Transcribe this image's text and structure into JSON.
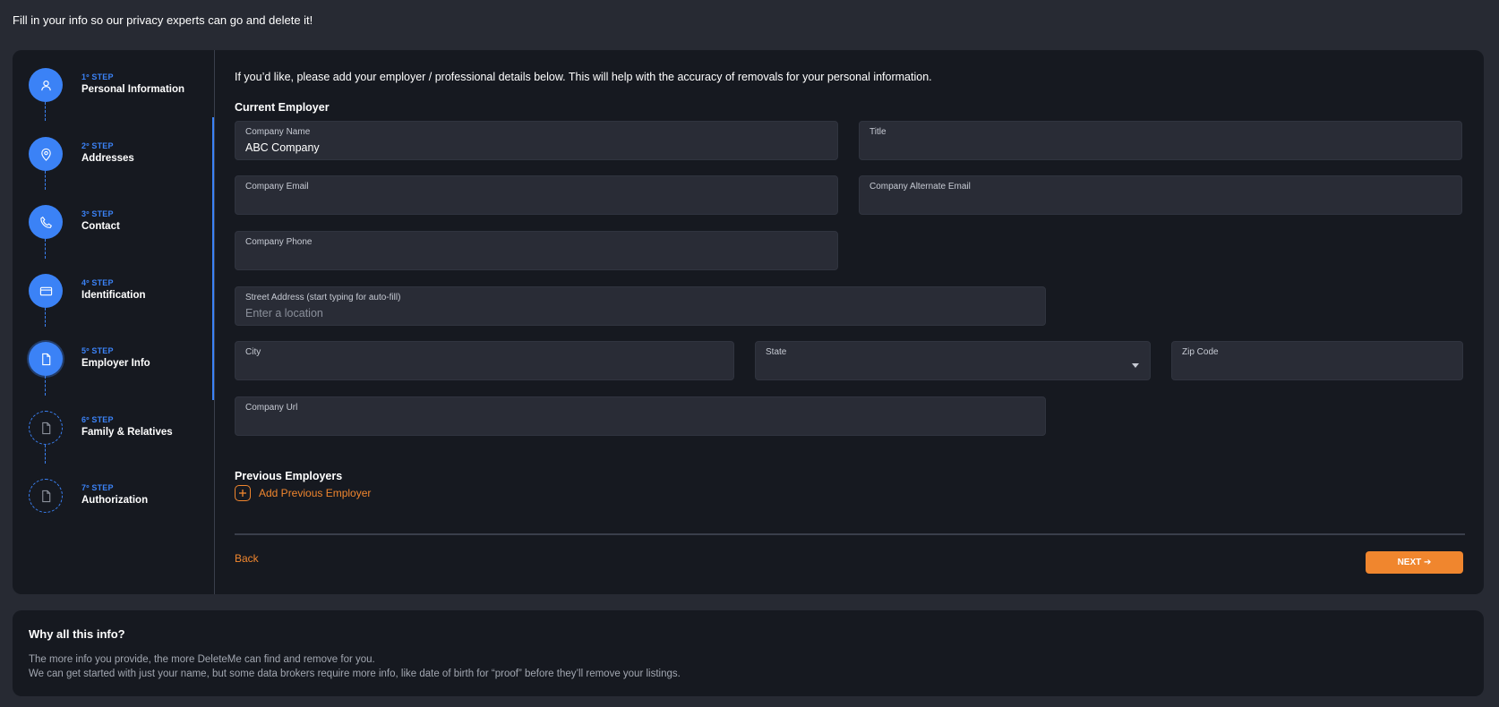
{
  "page": {
    "heading": "Fill in your info so our privacy experts can go and delete it!"
  },
  "colors": {
    "accent_blue": "#3b82f6",
    "accent_orange": "#f0862e",
    "card_bg": "#161920",
    "page_bg": "#272a33",
    "field_bg": "#292c36"
  },
  "stepper": {
    "steps": [
      {
        "number": "1º STEP",
        "label": "Personal Information",
        "icon": "person-icon",
        "state": "complete"
      },
      {
        "number": "2º STEP",
        "label": "Addresses",
        "icon": "location-pin-icon",
        "state": "complete"
      },
      {
        "number": "3º STEP",
        "label": "Contact",
        "icon": "phone-icon",
        "state": "complete"
      },
      {
        "number": "4º STEP",
        "label": "Identification",
        "icon": "id-card-icon",
        "state": "complete"
      },
      {
        "number": "5º STEP",
        "label": "Employer Info",
        "icon": "document-icon",
        "state": "active"
      },
      {
        "number": "6º STEP",
        "label": "Family & Relatives",
        "icon": "document-icon",
        "state": "pending"
      },
      {
        "number": "7º STEP",
        "label": "Authorization",
        "icon": "document-icon",
        "state": "pending"
      }
    ]
  },
  "form": {
    "intro": "If you’d like, please add your employer / professional details below. This will help with the accuracy of removals for your personal information.",
    "current_employer_title": "Current Employer",
    "company_name": {
      "label": "Company Name",
      "value": "ABC Company",
      "placeholder": ""
    },
    "title": {
      "label": "Title",
      "value": "",
      "placeholder": ""
    },
    "company_email": {
      "label": "Company Email",
      "value": "",
      "placeholder": ""
    },
    "company_alt_email": {
      "label": "Company Alternate Email",
      "value": "",
      "placeholder": ""
    },
    "company_phone": {
      "label": "Company Phone",
      "value": "",
      "placeholder": ""
    },
    "street_address": {
      "label": "Street Address (start typing for auto-fill)",
      "value": "",
      "placeholder": "Enter a location"
    },
    "city": {
      "label": "City",
      "value": "",
      "placeholder": ""
    },
    "state": {
      "label": "State",
      "value": "",
      "placeholder": ""
    },
    "zip": {
      "label": "Zip Code",
      "value": "",
      "placeholder": ""
    },
    "company_url": {
      "label": "Company Url",
      "value": "",
      "placeholder": ""
    },
    "previous_employers_title": "Previous Employers",
    "add_previous_label": "Add Previous Employer",
    "back_label": "Back",
    "next_label": "NEXT ➔"
  },
  "info": {
    "title": "Why all this info?",
    "line1": "The more info you provide, the more DeleteMe can find and remove for you.",
    "line2": "We can get started with just your name, but some data brokers require more info, like date of birth for “proof” before they’ll remove your listings."
  }
}
